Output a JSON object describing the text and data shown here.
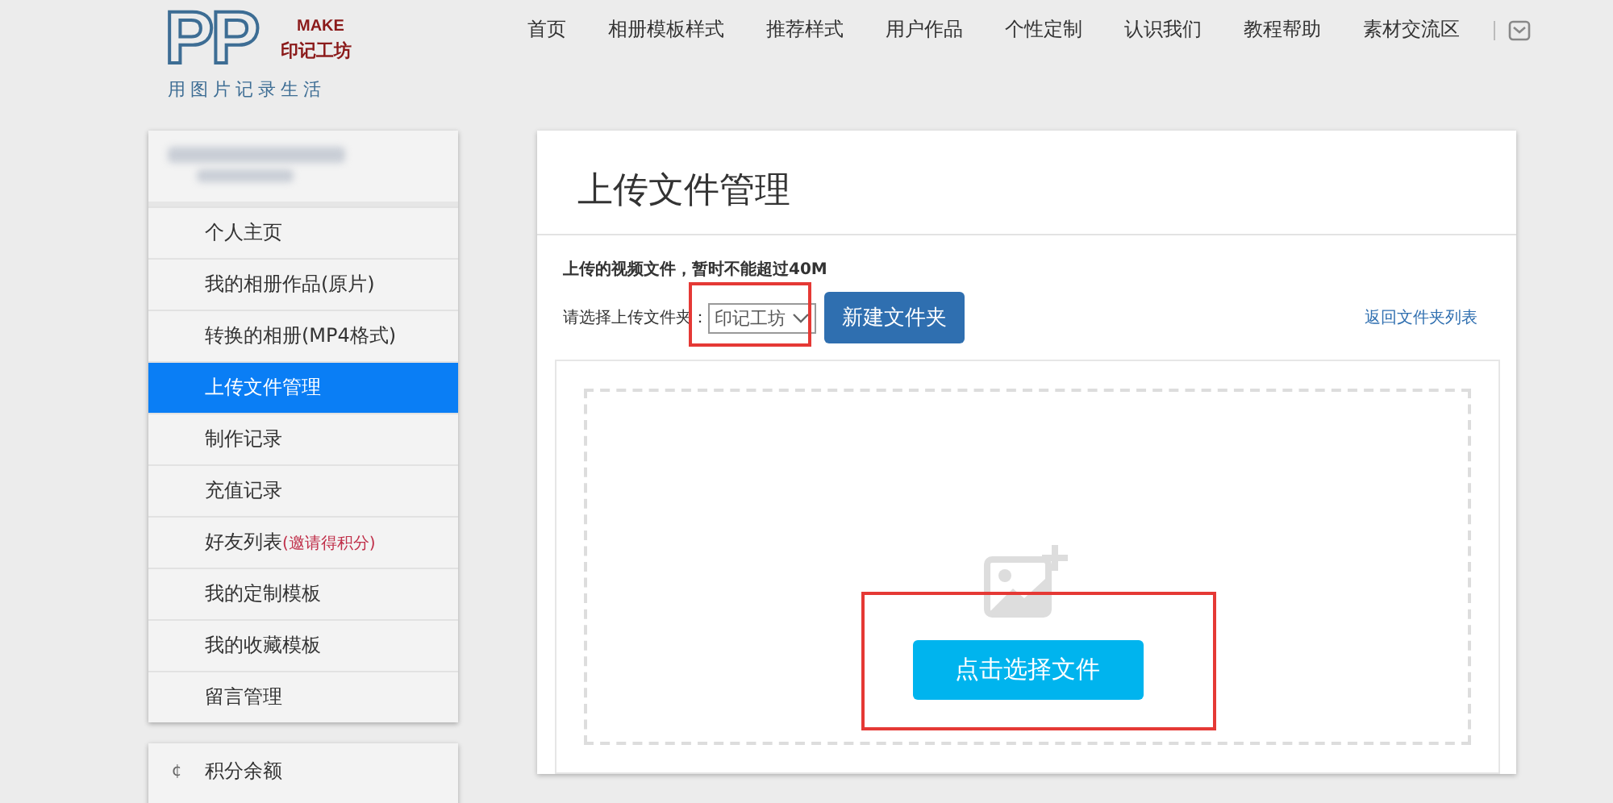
{
  "logo": {
    "mark": "PP",
    "make": "MAKE",
    "brand": "印记工坊",
    "slogan": "用图片记录生活"
  },
  "nav": [
    {
      "label": "首页"
    },
    {
      "label": "相册模板样式"
    },
    {
      "label": "推荐样式"
    },
    {
      "label": "用户作品"
    },
    {
      "label": "个性定制"
    },
    {
      "label": "认识我们"
    },
    {
      "label": "教程帮助"
    },
    {
      "label": "素材交流区"
    }
  ],
  "sidebar": {
    "items": [
      {
        "label": "个人主页",
        "selected": false
      },
      {
        "label": "我的相册作品(原片)",
        "selected": false
      },
      {
        "label": "转换的相册(MP4格式)",
        "selected": false
      },
      {
        "label": "上传文件管理",
        "selected": true
      },
      {
        "label": "制作记录",
        "selected": false
      },
      {
        "label": "充值记录",
        "selected": false
      },
      {
        "label": "好友列表",
        "note": "(邀请得积分)",
        "selected": false
      },
      {
        "label": "我的定制模板",
        "selected": false
      },
      {
        "label": "我的收藏模板",
        "selected": false
      },
      {
        "label": "留言管理",
        "selected": false
      }
    ],
    "second": [
      {
        "icon": "¢",
        "label": "积分余额"
      }
    ]
  },
  "main": {
    "title": "上传文件管理",
    "notice": "上传的视频文件，暂时不能超过40M",
    "folder_label": "请选择上传文件夹：",
    "folder_value": "印记工坊",
    "new_folder": "新建文件夹",
    "back_link": "返回文件夹列表",
    "choose_button": "点击选择文件"
  }
}
